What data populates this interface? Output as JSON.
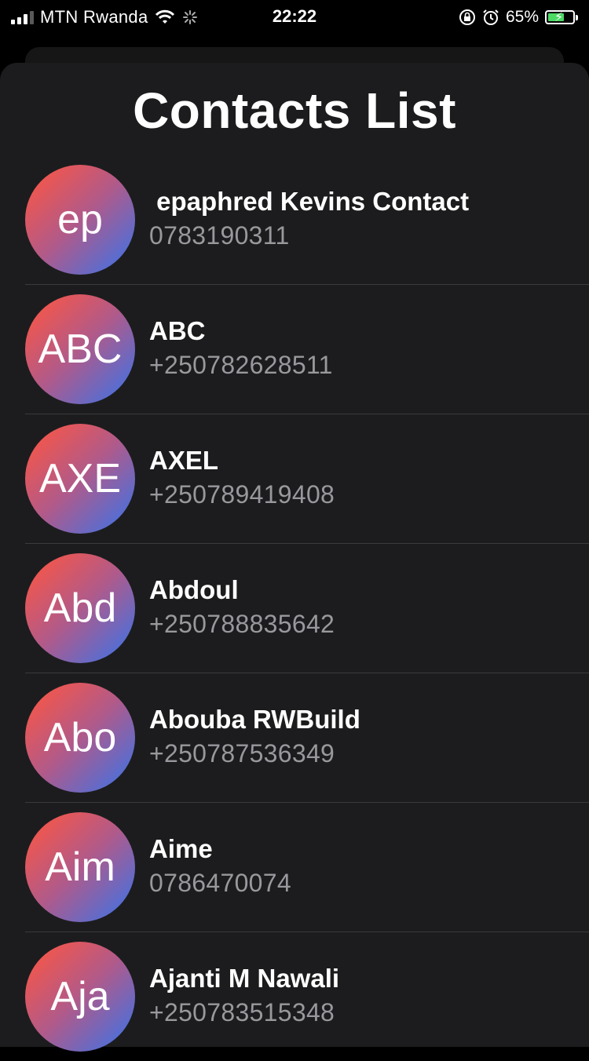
{
  "status_bar": {
    "carrier": "MTN Rwanda",
    "time": "22:22",
    "battery_percent": "65%",
    "battery_level": 0.65
  },
  "page": {
    "title": "Contacts List"
  },
  "contacts": [
    {
      "initials": "ep",
      "name": " epaphred Kevins Contact",
      "phone": "0783190311"
    },
    {
      "initials": "ABC",
      "name": "ABC",
      "phone": "+250782628511"
    },
    {
      "initials": "AXE",
      "name": "AXEL",
      "phone": "+250789419408"
    },
    {
      "initials": "Abd",
      "name": "Abdoul",
      "phone": "+250788835642"
    },
    {
      "initials": "Abo",
      "name": "Abouba RWBuild",
      "phone": "+250787536349"
    },
    {
      "initials": "Aim",
      "name": "Aime",
      "phone": "0786470074"
    },
    {
      "initials": "Aja",
      "name": "Ajanti M Nawali",
      "phone": "+250783515348"
    }
  ],
  "colors": {
    "background": "#000000",
    "sheet": "#1c1c1e",
    "avatar_gradient_start": "#f4564a",
    "avatar_gradient_end": "#3f72e4",
    "secondary_text": "#98989d"
  }
}
